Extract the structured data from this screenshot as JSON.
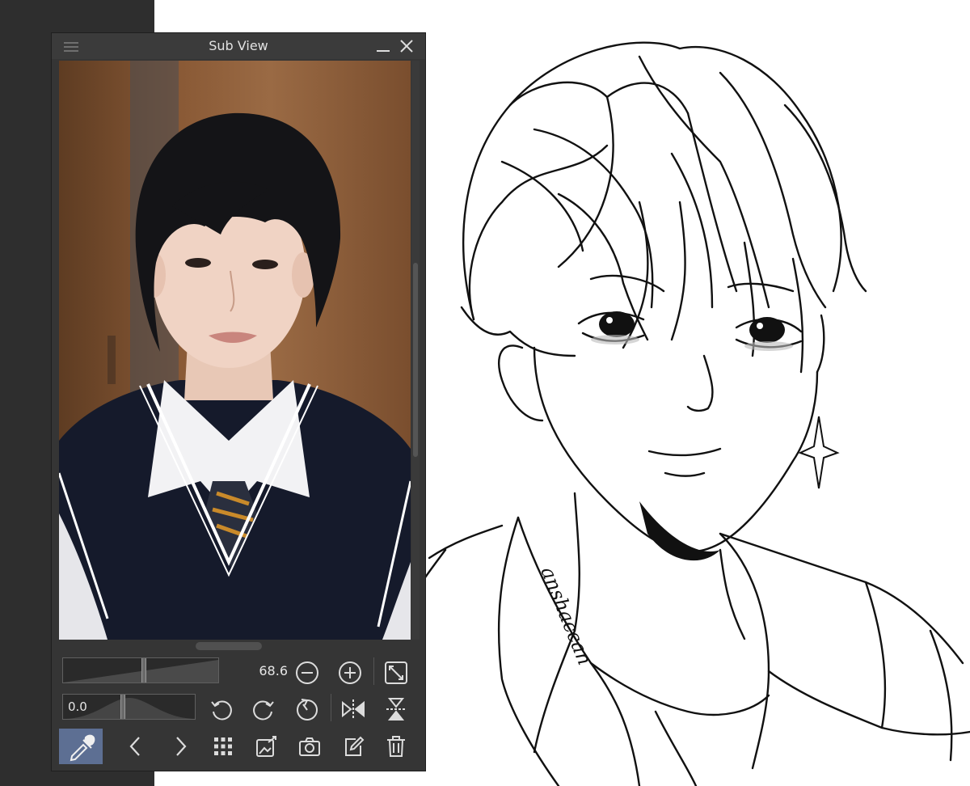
{
  "window": {
    "title": "Sub View"
  },
  "zoom": {
    "value": "68.6",
    "level": 0.52
  },
  "rotation": {
    "value": "0.0",
    "level": 0.45
  },
  "canvas": {
    "signature": "anshaccan"
  },
  "colors": {
    "panel": "#353535",
    "titlebar": "#3b3b3b",
    "accent": "#5d6f93",
    "workspace_left": "#2e2e2e",
    "canvas": "#ffffff"
  },
  "icons": [
    "menu-icon",
    "minimize-icon",
    "close-icon",
    "zoom-out-icon",
    "zoom-in-icon",
    "fit-window-icon",
    "rotate-left-icon",
    "rotate-right-icon",
    "reset-rotation-icon",
    "flip-horizontal-icon",
    "flip-vertical-icon",
    "eyedropper-icon",
    "previous-icon",
    "next-icon",
    "grid-icon",
    "import-image-icon",
    "camera-icon",
    "edit-icon",
    "trash-icon"
  ]
}
